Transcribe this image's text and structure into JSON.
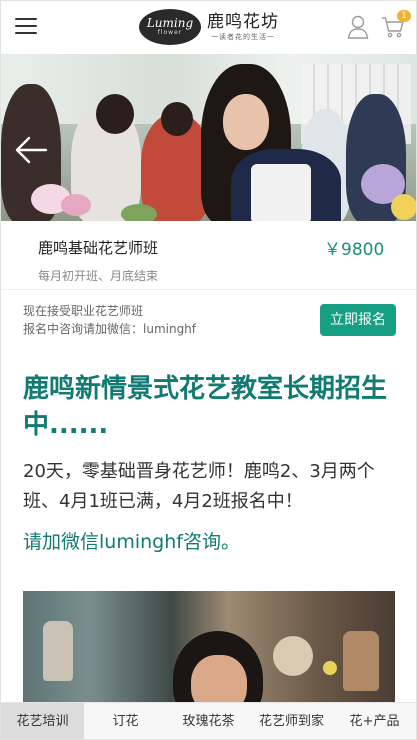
{
  "header": {
    "menu_icon": "hamburger-menu-icon",
    "logo": {
      "script_text": "Luming",
      "script_sub": "flower",
      "brand_cn": "鹿鸣花坊",
      "tagline": "一读者花的生活一"
    },
    "user_icon": "user-icon",
    "cart_icon": "cart-icon",
    "cart_count": "1"
  },
  "hero": {
    "back_icon": "arrow-left-icon"
  },
  "course": {
    "title": "鹿鸣基础花艺师班",
    "price": "￥9800",
    "schedule": "每月初开班、月底结束",
    "notice_line1": "现在接受职业花艺师班",
    "notice_line2": "报名中咨询请加微信：luminghf",
    "signup_label": "立即报名"
  },
  "article": {
    "title": "鹿鸣新情景式花艺教室长期招生中......",
    "body": "20天，零基础晋身花艺师！鹿鸣2、3月两个班、4月1班已满，4月2班报名中！",
    "contact": "请加微信luminghf咨询。"
  },
  "bottom_nav": {
    "items": [
      {
        "label": "花艺培训",
        "active": true
      },
      {
        "label": "订花",
        "active": false
      },
      {
        "label": "玫瑰花茶",
        "active": false
      },
      {
        "label": "花艺师到家",
        "active": false
      },
      {
        "label": "花+产品",
        "active": false
      }
    ]
  },
  "colors": {
    "accent": "#169f83",
    "title_teal": "#117a72",
    "price": "#1d8f7a",
    "badge": "#f2b134"
  }
}
